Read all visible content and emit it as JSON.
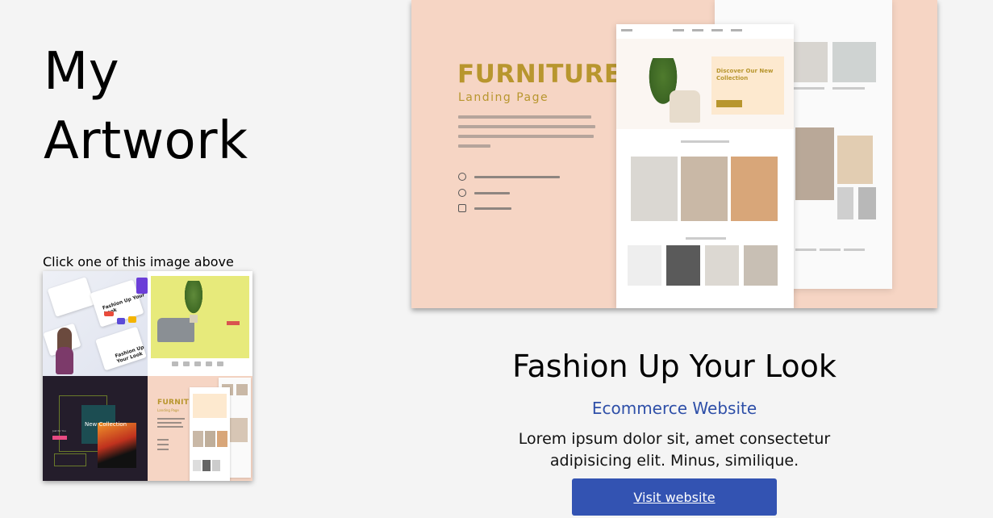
{
  "heading": {
    "line1": "My",
    "line2": "Artwork"
  },
  "gallery": {
    "hint": "Click one of this image above",
    "thumbs": [
      {
        "name": "fashion-ecommerce",
        "text_a": "Fashion Up Your Look",
        "text_b": "Fashion Up Your Look"
      },
      {
        "name": "yellow-chair",
        "text": ""
      },
      {
        "name": "new-collection",
        "text": "New Collection",
        "small": "Just for You"
      },
      {
        "name": "furniture",
        "title": "FURNITURE",
        "sub": "Landing Page"
      }
    ]
  },
  "preview": {
    "title": "FURNITURE",
    "subtitle": "Landing Page",
    "mock_card_title": "Discover Our New Collection"
  },
  "project": {
    "title": "Fashion Up Your Look",
    "category": "Ecommerce Website",
    "description": "Lorem ipsum dolor sit, amet consectetur adipisicing elit. Minus, similique.",
    "button_label": "Visit website"
  },
  "colors": {
    "background": "#f4f4f4",
    "accent_blue": "#3353b2",
    "link_blue": "#2e4fa8",
    "furniture_peach": "#f6d5c4",
    "furniture_gold": "#b8962e"
  }
}
